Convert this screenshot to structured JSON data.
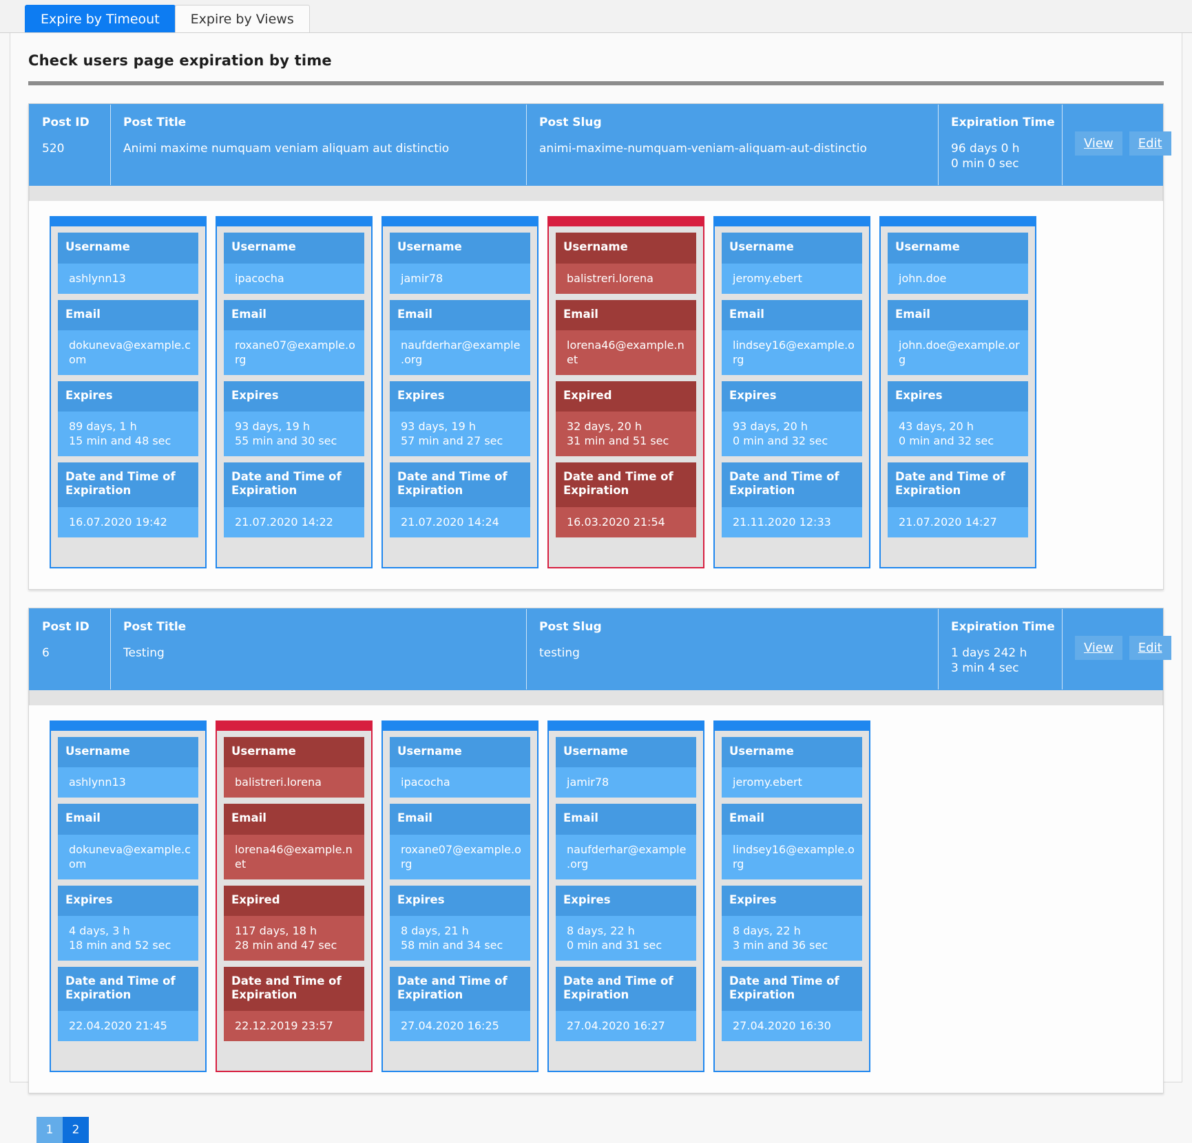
{
  "tabs": [
    {
      "label": "Expire by Timeout",
      "active": true
    },
    {
      "label": "Expire by Views",
      "active": false
    }
  ],
  "page": {
    "title": "Check users page expiration by time"
  },
  "header_labels": {
    "post_id": "Post ID",
    "post_title": "Post Title",
    "post_slug": "Post Slug",
    "expiration_time": "Expiration Time",
    "view": "View",
    "edit": "Edit"
  },
  "card_labels": {
    "username": "Username",
    "email": "Email",
    "expires": "Expires",
    "expired": "Expired",
    "date_and_time": "Date and Time of\nExpiration"
  },
  "colors": {
    "accent_blue": "#1f87ef",
    "header_blue": "#4a9fe8",
    "field_label_blue": "#459ae2",
    "field_value_blue": "#5cb2f7",
    "expired_red": "#d71e3f",
    "field_label_red": "#9d3b38",
    "field_value_red": "#bd5451",
    "card_bg": "#e2e2e2"
  },
  "posts": [
    {
      "id": "520",
      "title": "Animi maxime numquam veniam aliquam aut distinctio",
      "slug": "animi-maxime-numquam-veniam-aliquam-aut-distinctio",
      "expiration_time": "96 days 0 h\n0 min 0 sec",
      "users": [
        {
          "username": "ashlynn13",
          "email": "dokuneva@example.com",
          "status": "Expires",
          "remaining": "89 days, 1 h\n15 min and 48 sec",
          "date": "16.07.2020 19:42",
          "expired": false
        },
        {
          "username": "ipacocha",
          "email": "roxane07@example.org",
          "status": "Expires",
          "remaining": "93 days, 19 h\n55 min and 30 sec",
          "date": "21.07.2020 14:22",
          "expired": false
        },
        {
          "username": "jamir78",
          "email": "naufderhar@example.org",
          "status": "Expires",
          "remaining": "93 days, 19 h\n57 min and 27 sec",
          "date": "21.07.2020 14:24",
          "expired": false
        },
        {
          "username": "balistreri.lorena",
          "email": "lorena46@example.net",
          "status": "Expired",
          "remaining": "32 days, 20 h\n31 min and 51 sec",
          "date": "16.03.2020 21:54",
          "expired": true
        },
        {
          "username": "jeromy.ebert",
          "email": "lindsey16@example.org",
          "status": "Expires",
          "remaining": "93 days, 20 h\n0 min and 32 sec",
          "date": "21.11.2020 12:33",
          "expired": false
        },
        {
          "username": "john.doe",
          "email": "john.doe@example.org",
          "status": "Expires",
          "remaining": "43 days, 20 h\n0 min and 32 sec",
          "date": "21.07.2020 14:27",
          "expired": false
        }
      ]
    },
    {
      "id": "6",
      "title": "Testing",
      "slug": "testing",
      "expiration_time": "1 days 242 h\n3 min 4 sec",
      "users": [
        {
          "username": "ashlynn13",
          "email": "dokuneva@example.com",
          "status": "Expires",
          "remaining": "4 days, 3 h\n18 min and 52 sec",
          "date": "22.04.2020 21:45",
          "expired": false
        },
        {
          "username": "balistreri.lorena",
          "email": "lorena46@example.net",
          "status": "Expired",
          "remaining": "117 days, 18 h\n28 min and 47 sec",
          "date": "22.12.2019 23:57",
          "expired": true
        },
        {
          "username": "ipacocha",
          "email": "roxane07@example.org",
          "status": "Expires",
          "remaining": "8 days, 21 h\n58 min and 34 sec",
          "date": "27.04.2020 16:25",
          "expired": false
        },
        {
          "username": "jamir78",
          "email": "naufderhar@example.org",
          "status": "Expires",
          "remaining": "8 days, 22 h\n0 min and 31 sec",
          "date": "27.04.2020 16:27",
          "expired": false
        },
        {
          "username": "jeromy.ebert",
          "email": "lindsey16@example.org",
          "status": "Expires",
          "remaining": "8 days, 22 h\n3 min and 36 sec",
          "date": "27.04.2020 16:30",
          "expired": false
        }
      ]
    }
  ],
  "pagination": {
    "pages": [
      "1",
      "2"
    ],
    "current": "2"
  }
}
